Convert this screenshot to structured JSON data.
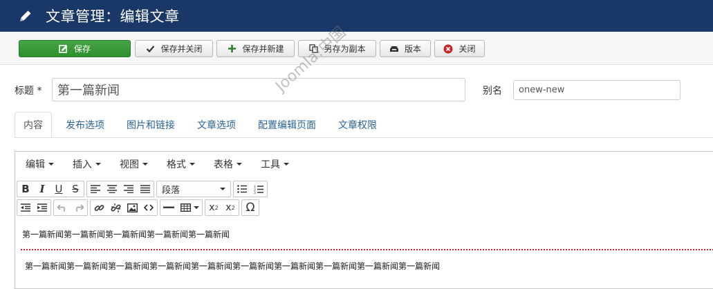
{
  "header": {
    "title": "文章管理：编辑文章",
    "icon": "pencil-icon",
    "background": "#1a3867"
  },
  "toolbar": {
    "save": "保存",
    "save_close": "保存并关闭",
    "save_new": "保存并新建",
    "save_copy": "另存为副本",
    "versions": "版本",
    "close": "关闭"
  },
  "form": {
    "title_label": "标题 *",
    "title_value": "第一篇新闻",
    "alias_label": "别名",
    "alias_value": "onew-new"
  },
  "tabs": [
    "内容",
    "发布选项",
    "图片和链接",
    "文章选项",
    "配置编辑页面",
    "文章权限"
  ],
  "editor": {
    "menus": [
      "编辑",
      "插入",
      "视图",
      "格式",
      "表格",
      "工具"
    ],
    "format_select": "段落",
    "paragraph_1": "第一篇新闻第一篇新闻第一篇新闻第一篇新闻第一篇新闻",
    "paragraph_2": "第一篇新闻第一篇新闻第一篇新闻第一篇新闻第一篇新闻第一篇新闻第一篇新闻第一篇新闻第一篇新闻第一篇新闻"
  },
  "watermark": "Joomla!中国",
  "colors": {
    "save_green": "#46a546",
    "link_blue": "#2a6496",
    "pagebreak_red": "#e01b1b"
  }
}
